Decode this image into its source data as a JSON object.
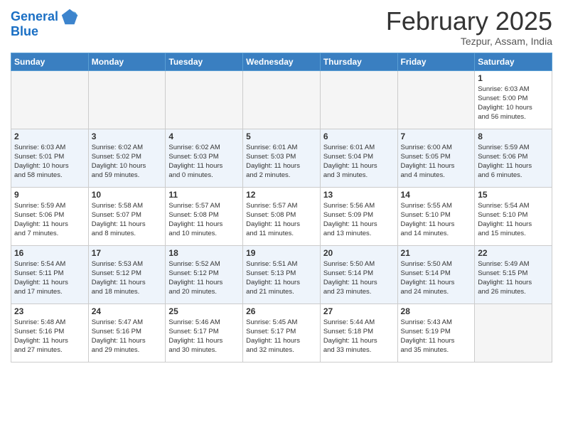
{
  "header": {
    "logo_line1": "General",
    "logo_line2": "Blue",
    "month": "February 2025",
    "location": "Tezpur, Assam, India"
  },
  "weekdays": [
    "Sunday",
    "Monday",
    "Tuesday",
    "Wednesday",
    "Thursday",
    "Friday",
    "Saturday"
  ],
  "weeks": [
    [
      {
        "day": "",
        "info": ""
      },
      {
        "day": "",
        "info": ""
      },
      {
        "day": "",
        "info": ""
      },
      {
        "day": "",
        "info": ""
      },
      {
        "day": "",
        "info": ""
      },
      {
        "day": "",
        "info": ""
      },
      {
        "day": "1",
        "info": "Sunrise: 6:03 AM\nSunset: 5:00 PM\nDaylight: 10 hours\nand 56 minutes."
      }
    ],
    [
      {
        "day": "2",
        "info": "Sunrise: 6:03 AM\nSunset: 5:01 PM\nDaylight: 10 hours\nand 58 minutes."
      },
      {
        "day": "3",
        "info": "Sunrise: 6:02 AM\nSunset: 5:02 PM\nDaylight: 10 hours\nand 59 minutes."
      },
      {
        "day": "4",
        "info": "Sunrise: 6:02 AM\nSunset: 5:03 PM\nDaylight: 11 hours\nand 0 minutes."
      },
      {
        "day": "5",
        "info": "Sunrise: 6:01 AM\nSunset: 5:03 PM\nDaylight: 11 hours\nand 2 minutes."
      },
      {
        "day": "6",
        "info": "Sunrise: 6:01 AM\nSunset: 5:04 PM\nDaylight: 11 hours\nand 3 minutes."
      },
      {
        "day": "7",
        "info": "Sunrise: 6:00 AM\nSunset: 5:05 PM\nDaylight: 11 hours\nand 4 minutes."
      },
      {
        "day": "8",
        "info": "Sunrise: 5:59 AM\nSunset: 5:06 PM\nDaylight: 11 hours\nand 6 minutes."
      }
    ],
    [
      {
        "day": "9",
        "info": "Sunrise: 5:59 AM\nSunset: 5:06 PM\nDaylight: 11 hours\nand 7 minutes."
      },
      {
        "day": "10",
        "info": "Sunrise: 5:58 AM\nSunset: 5:07 PM\nDaylight: 11 hours\nand 8 minutes."
      },
      {
        "day": "11",
        "info": "Sunrise: 5:57 AM\nSunset: 5:08 PM\nDaylight: 11 hours\nand 10 minutes."
      },
      {
        "day": "12",
        "info": "Sunrise: 5:57 AM\nSunset: 5:08 PM\nDaylight: 11 hours\nand 11 minutes."
      },
      {
        "day": "13",
        "info": "Sunrise: 5:56 AM\nSunset: 5:09 PM\nDaylight: 11 hours\nand 13 minutes."
      },
      {
        "day": "14",
        "info": "Sunrise: 5:55 AM\nSunset: 5:10 PM\nDaylight: 11 hours\nand 14 minutes."
      },
      {
        "day": "15",
        "info": "Sunrise: 5:54 AM\nSunset: 5:10 PM\nDaylight: 11 hours\nand 15 minutes."
      }
    ],
    [
      {
        "day": "16",
        "info": "Sunrise: 5:54 AM\nSunset: 5:11 PM\nDaylight: 11 hours\nand 17 minutes."
      },
      {
        "day": "17",
        "info": "Sunrise: 5:53 AM\nSunset: 5:12 PM\nDaylight: 11 hours\nand 18 minutes."
      },
      {
        "day": "18",
        "info": "Sunrise: 5:52 AM\nSunset: 5:12 PM\nDaylight: 11 hours\nand 20 minutes."
      },
      {
        "day": "19",
        "info": "Sunrise: 5:51 AM\nSunset: 5:13 PM\nDaylight: 11 hours\nand 21 minutes."
      },
      {
        "day": "20",
        "info": "Sunrise: 5:50 AM\nSunset: 5:14 PM\nDaylight: 11 hours\nand 23 minutes."
      },
      {
        "day": "21",
        "info": "Sunrise: 5:50 AM\nSunset: 5:14 PM\nDaylight: 11 hours\nand 24 minutes."
      },
      {
        "day": "22",
        "info": "Sunrise: 5:49 AM\nSunset: 5:15 PM\nDaylight: 11 hours\nand 26 minutes."
      }
    ],
    [
      {
        "day": "23",
        "info": "Sunrise: 5:48 AM\nSunset: 5:16 PM\nDaylight: 11 hours\nand 27 minutes."
      },
      {
        "day": "24",
        "info": "Sunrise: 5:47 AM\nSunset: 5:16 PM\nDaylight: 11 hours\nand 29 minutes."
      },
      {
        "day": "25",
        "info": "Sunrise: 5:46 AM\nSunset: 5:17 PM\nDaylight: 11 hours\nand 30 minutes."
      },
      {
        "day": "26",
        "info": "Sunrise: 5:45 AM\nSunset: 5:17 PM\nDaylight: 11 hours\nand 32 minutes."
      },
      {
        "day": "27",
        "info": "Sunrise: 5:44 AM\nSunset: 5:18 PM\nDaylight: 11 hours\nand 33 minutes."
      },
      {
        "day": "28",
        "info": "Sunrise: 5:43 AM\nSunset: 5:19 PM\nDaylight: 11 hours\nand 35 minutes."
      },
      {
        "day": "",
        "info": ""
      }
    ]
  ]
}
